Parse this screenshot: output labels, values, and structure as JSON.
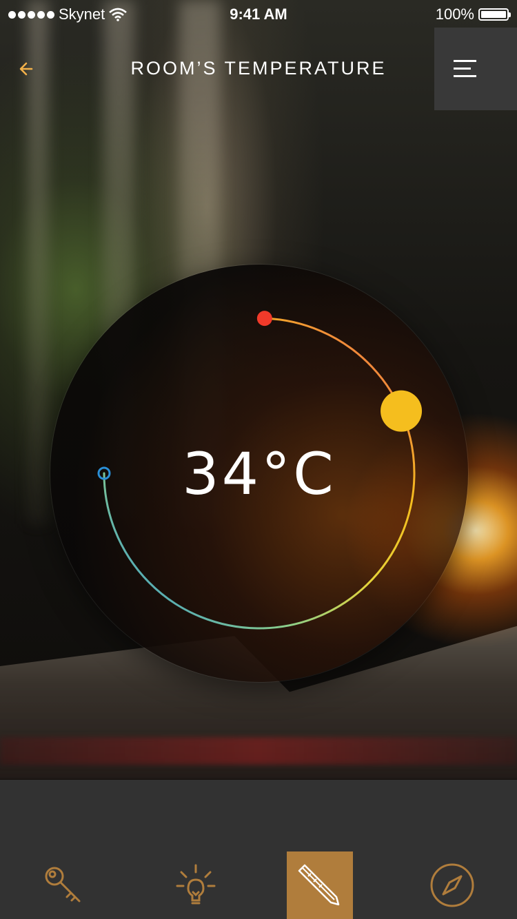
{
  "status_bar": {
    "carrier": "Skynet",
    "time": "9:41 AM",
    "battery": "100%",
    "signal_bars": 5,
    "battery_level": 1.0,
    "icons": [
      "signal-dots-icon",
      "wifi-icon",
      "battery-icon"
    ]
  },
  "navbar": {
    "title": "ROOM’S TEMPERATURE",
    "back_icon": "back-arrow-icon",
    "menu_icon": "hamburger-menu-icon"
  },
  "thermostat": {
    "temperature": "34°C",
    "knob_color": "#f5be1e",
    "arc_gradient": [
      "#2a8fd6",
      "#4fb0b8",
      "#e6d43a",
      "#f5be1e",
      "#f08a3a",
      "#f03a2a"
    ],
    "max_marker_color": "#f03a2a",
    "min_marker_color": "#2a8fd6",
    "level": 0.76
  },
  "tab_bar": {
    "tabs": [
      {
        "name": "key",
        "icon": "key-icon",
        "active": false
      },
      {
        "name": "light",
        "icon": "lightbulb-icon",
        "active": true,
        "active_hint": false
      },
      {
        "name": "temperature",
        "icon": "thermometer-icon",
        "active": true
      },
      {
        "name": "compass",
        "icon": "compass-icon",
        "active": false
      }
    ],
    "icon_color": "#b07d3c",
    "active_bg": "#b07d3c"
  }
}
